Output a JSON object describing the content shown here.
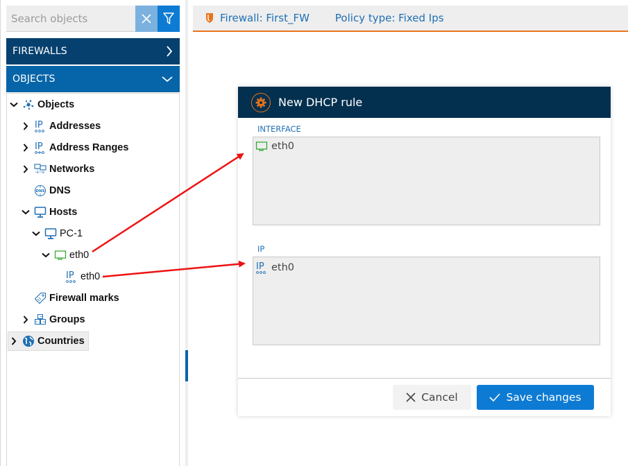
{
  "search": {
    "placeholder": "Search objects",
    "value": ""
  },
  "accordion": {
    "firewalls_label": "FIREWALLS",
    "objects_label": "OBJECTS"
  },
  "tree": {
    "items": [
      {
        "label": "Objects",
        "icon": "objects-network-icon",
        "expanded": true,
        "bold": true
      },
      {
        "label": "Addresses",
        "icon": "ip-address-icon",
        "expanded": false,
        "bold": true
      },
      {
        "label": "Address Ranges",
        "icon": "ip-range-icon",
        "expanded": false,
        "bold": true
      },
      {
        "label": "Networks",
        "icon": "networks-icon",
        "expanded": false,
        "bold": true
      },
      {
        "label": "DNS",
        "icon": "dns-icon",
        "bold": true
      },
      {
        "label": "Hosts",
        "icon": "monitor-icon",
        "expanded": true,
        "bold": true
      },
      {
        "label": "PC-1",
        "icon": "monitor-icon",
        "expanded": true,
        "bold": false
      },
      {
        "label": "eth0",
        "icon": "network-card-icon",
        "expanded": true,
        "bold": false
      },
      {
        "label": "eth0",
        "icon": "ip-address-icon",
        "bold": false
      },
      {
        "label": "Firewall marks",
        "icon": "tag-icon",
        "bold": true
      },
      {
        "label": "Groups",
        "icon": "cubes-icon",
        "expanded": false,
        "bold": true
      },
      {
        "label": "Countries",
        "icon": "globe-icon",
        "expanded": false,
        "bold": true,
        "selected": true
      }
    ]
  },
  "tab": {
    "firewall": "Firewall: First_FW",
    "policy_type": "Policy type: Fixed Ips"
  },
  "dialog": {
    "title": "New DHCP rule",
    "interface_label": "INTERFACE",
    "interface_value": "eth0",
    "ip_label": "IP",
    "ip_value": "eth0",
    "cancel_label": "Cancel",
    "save_label": "Save changes"
  },
  "colors": {
    "accent_orange": "#e8731c",
    "primary_blue": "#0d7bd3",
    "dark_navy": "#03304f",
    "firewalls_header": "#06406f",
    "objects_header": "#0665a8",
    "interface_green": "#2aa52a",
    "annotation_red": "#ee1111"
  }
}
